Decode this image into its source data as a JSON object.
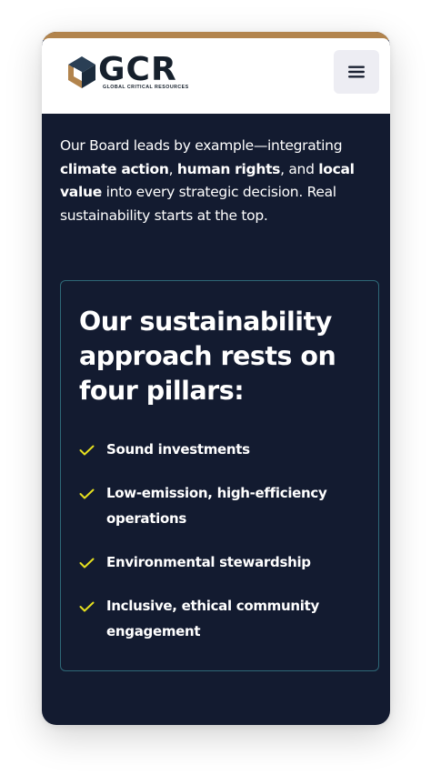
{
  "colors": {
    "accent_strip": "#b2844d",
    "background": "#131b30",
    "header_background": "#ffffff",
    "card_border": "#2e6877",
    "check": "#e6e01f",
    "text": "#ffffff"
  },
  "header": {
    "logo_letters": "GCR",
    "logo_tagline": "GLOBAL CRITICAL RESOURCES",
    "menu_icon": "hamburger-menu-icon"
  },
  "intro": {
    "segments": [
      "Our Board leads by example—integrating ",
      "climate action",
      ", ",
      "human rights",
      ", and ",
      "local value",
      " into every strategic decision. Real sustainability starts at the top."
    ]
  },
  "pillars": {
    "heading": "Our sustainability approach rests on four pillars:",
    "check_icon": "checkmark-icon",
    "items": [
      "Sound investments",
      "Low-emission, high-efficiency operations",
      "Environmental stewardship",
      "Inclusive, ethical community engagement"
    ]
  }
}
